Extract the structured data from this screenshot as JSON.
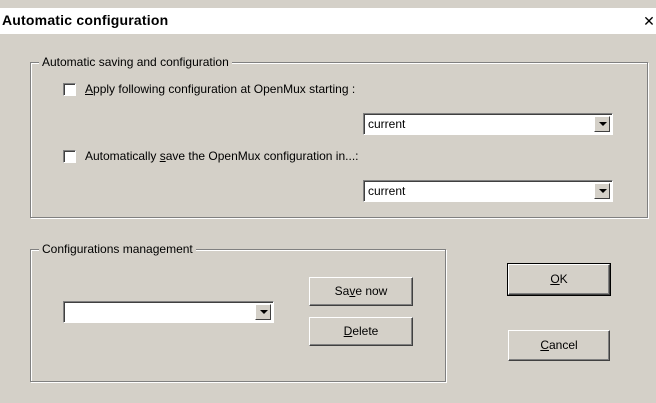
{
  "window": {
    "title": "Automatic configuration",
    "close_glyph": "✕"
  },
  "auto_group": {
    "legend": "Automatic saving and configuration",
    "apply_option": {
      "checked": false,
      "label_prefix": "",
      "label_mnemonic": "A",
      "label_rest": "pply following configuration at OpenMux starting :",
      "select_value": "current"
    },
    "save_option": {
      "checked": false,
      "label_prefix": "Automatically ",
      "label_mnemonic": "s",
      "label_rest": "ave the OpenMux configuration in...:",
      "select_value": "current"
    }
  },
  "management_group": {
    "legend": "Configurations management",
    "select_value": "",
    "save_now": {
      "prefix": "Sa",
      "mnemonic": "v",
      "rest": "e now"
    },
    "delete": {
      "prefix": "",
      "mnemonic": "D",
      "rest": "elete"
    }
  },
  "buttons": {
    "ok": {
      "prefix": "",
      "mnemonic": "O",
      "rest": "K"
    },
    "cancel": {
      "prefix": "",
      "mnemonic": "C",
      "rest": "ancel"
    }
  },
  "icons": {
    "dropdown": "chevron-down-icon",
    "close": "close-icon"
  }
}
